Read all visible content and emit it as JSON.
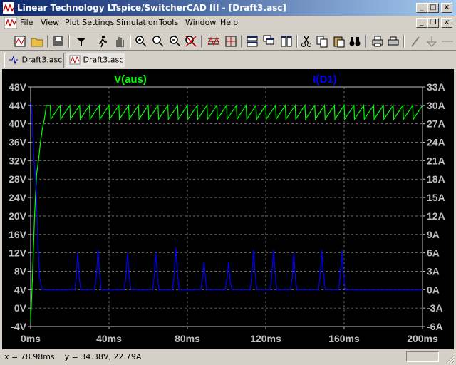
{
  "window": {
    "title": "Linear Technology LTspice/SwitcherCAD III - [Draft3.asc]"
  },
  "menu": [
    "File",
    "View",
    "Plot Settings",
    "Simulation",
    "Tools",
    "Window",
    "Help"
  ],
  "tabs": [
    {
      "label": "Draft3.asc",
      "icon": "schematic-icon"
    },
    {
      "label": "Draft3.asc",
      "icon": "waveform-icon",
      "active": true
    }
  ],
  "status": {
    "cursor": "x = 78.98ms    y = 34.38V, 22.79A"
  },
  "colors": {
    "v_trace": "#00ff00",
    "i_trace": "#0000ff",
    "plot_bg": "#000000",
    "axis_text": "#c0c0c0"
  },
  "chart_data": {
    "type": "line",
    "x_ticks": [
      "0ms",
      "40ms",
      "80ms",
      "120ms",
      "160ms",
      "200ms"
    ],
    "xlim": [
      0,
      200
    ],
    "y_left_ticks": [
      "48V",
      "44V",
      "40V",
      "36V",
      "32V",
      "28V",
      "24V",
      "20V",
      "16V",
      "12V",
      "8V",
      "4V",
      "0V",
      "-4V"
    ],
    "y_left_lim": [
      -4,
      48
    ],
    "y_right_ticks": [
      "33A",
      "30A",
      "27A",
      "24A",
      "21A",
      "18A",
      "15A",
      "12A",
      "9A",
      "6A",
      "3A",
      "0A",
      "-3A",
      "-6A"
    ],
    "y_right_lim": [
      -6,
      33
    ],
    "grid": true,
    "series": [
      {
        "name": "V(aus)",
        "axis": "left",
        "x": [
          0,
          0.5,
          1.2,
          2.0,
          3.0,
          4.0,
          5.0,
          6.0,
          7.0,
          8.0,
          10.0,
          10.3,
          15.0,
          15.3,
          20.0,
          20.3,
          25.0,
          25.3,
          30.0,
          30.3,
          35.0,
          35.3,
          40.0,
          40.3,
          45.0,
          45.3,
          50.0,
          50.3,
          55.0,
          55.3,
          60.0,
          60.3,
          65.0,
          65.3,
          70.0,
          70.3,
          75.0,
          75.3,
          80.0,
          80.3,
          85.0,
          85.3,
          90.0,
          90.3,
          95.0,
          95.3,
          100.0,
          100.3,
          105.0,
          105.3,
          110.0,
          110.3,
          115.0,
          115.3,
          120.0,
          120.3,
          125.0,
          125.3,
          130.0,
          130.3,
          135.0,
          135.3,
          140.0,
          140.3,
          145.0,
          145.3,
          150.0,
          150.3,
          155.0,
          155.3,
          160.0,
          160.3,
          165.0,
          165.3,
          170.0,
          170.3,
          175.0,
          175.3,
          180.0,
          180.3,
          185.0,
          185.3,
          190.0,
          190.3,
          195.0,
          195.3,
          200.0
        ],
        "y": [
          -3,
          2,
          10,
          20,
          29,
          32,
          36,
          39,
          41,
          44,
          44,
          41,
          44,
          41,
          44,
          41,
          44,
          41,
          44,
          41,
          44,
          41,
          44,
          41,
          44,
          41,
          44,
          41,
          44,
          41,
          44,
          41,
          44,
          41,
          44,
          41,
          44,
          41,
          44,
          41,
          44,
          41,
          44,
          41,
          44,
          41,
          44,
          41,
          44,
          41,
          44,
          41,
          44,
          41,
          44,
          41,
          44,
          41,
          44,
          41,
          44,
          41,
          44,
          41,
          44,
          41,
          44,
          41,
          44,
          41,
          44,
          41,
          44,
          41,
          44,
          41,
          44,
          41,
          44,
          41,
          44,
          41,
          44,
          41,
          44,
          41,
          44
        ]
      },
      {
        "name": "I(D1)",
        "axis": "right",
        "x": [
          0,
          0.3,
          0.8,
          1.5,
          2.5,
          3.5,
          4.5,
          5.5,
          6.0,
          7.0,
          20.0,
          22.5,
          23.3,
          24.0,
          24.8,
          25.6,
          26.5,
          30.0,
          32.7,
          33.6,
          34.4,
          35.2,
          36.0,
          37.0,
          45.0,
          47.8,
          48.6,
          49.5,
          50.3,
          51.2,
          52.0,
          60.0,
          62.2,
          63.0,
          63.9,
          64.7,
          65.5,
          66.3,
          70.0,
          72.4,
          73.3,
          74.1,
          74.9,
          75.7,
          76.5,
          84.0,
          86.8,
          87.6,
          88.5,
          89.3,
          90.1,
          91.0,
          96.0,
          99.2,
          100.1,
          101.0,
          101.8,
          102.7,
          103.5,
          110.0,
          112.1,
          112.9,
          113.8,
          114.6,
          115.5,
          116.3,
          120.0,
          122.3,
          123.1,
          124.0,
          124.8,
          125.6,
          126.4,
          130.0,
          132.6,
          133.5,
          134.3,
          135.1,
          135.9,
          136.7,
          145.0,
          146.9,
          147.8,
          148.6,
          149.5,
          150.3,
          151.1,
          155.0,
          157.2,
          158.0,
          158.9,
          159.7,
          160.5,
          161.3,
          200.0
        ],
        "y": [
          30.5,
          30,
          28,
          22,
          18,
          10,
          2,
          0.5,
          0,
          0,
          0,
          0,
          2,
          6,
          2,
          0,
          0,
          0,
          0,
          2.5,
          6.5,
          2.5,
          0,
          0,
          0,
          0,
          2,
          6,
          2,
          0,
          0,
          0,
          0,
          2,
          6,
          2,
          0,
          0,
          0,
          0,
          2.5,
          6.8,
          2.5,
          0,
          0,
          0,
          0,
          1.5,
          4.5,
          1.5,
          0,
          0,
          0,
          0,
          1.5,
          4.5,
          1.5,
          0,
          0,
          0,
          0,
          2.5,
          6.5,
          2.5,
          0,
          0,
          0,
          0,
          2.5,
          6.5,
          2.5,
          0,
          0,
          0,
          0,
          2,
          6,
          2,
          0,
          0,
          0,
          0,
          2.5,
          6.5,
          2.5,
          0,
          0,
          0,
          0,
          2.5,
          6.5,
          2.5,
          0,
          0,
          0
        ]
      }
    ]
  }
}
